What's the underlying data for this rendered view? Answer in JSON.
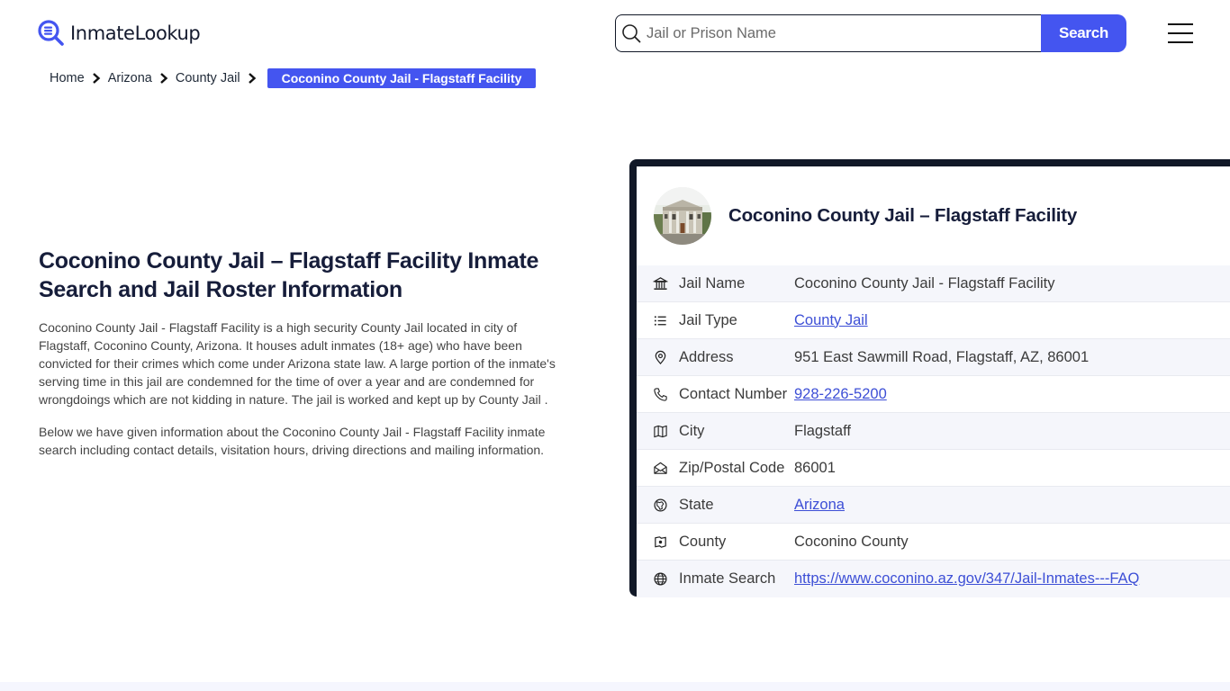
{
  "header": {
    "logo_text": "InmateLookup",
    "search": {
      "placeholder": "Jail or Prison Name",
      "value": "",
      "button_label": "Search"
    },
    "menu_icon": "hamburger-menu-icon"
  },
  "breadcrumb": {
    "items": [
      {
        "label": "Home"
      },
      {
        "label": "Arizona"
      },
      {
        "label": "County Jail"
      }
    ],
    "current": "Coconino County Jail - Flagstaff Facility"
  },
  "intro": {
    "title": "Coconino County Jail – Flagstaff Facility Inmate Search and Jail Roster Information",
    "paragraphs": [
      "Coconino County Jail - Flagstaff Facility is a high security County Jail located in city of Flagstaff, Coconino County, Arizona. It houses adult inmates (18+ age) who have been convicted for their crimes which come under Arizona state law. A large portion of the inmate's serving time in this jail are condemned for the time of over a year and are condemned for wrongdoings which are not kidding in nature. The jail is worked and kept up by County Jail .",
      "Below we have given information about the Coconino County Jail - Flagstaff Facility inmate search including contact details, visitation hours, driving directions and mailing information."
    ]
  },
  "card": {
    "title": "Coconino County Jail – Flagstaff Facility",
    "rows": [
      {
        "icon": "building-columns-icon",
        "label": "Jail Name",
        "value": "Coconino County Jail - Flagstaff Facility",
        "link": false
      },
      {
        "icon": "list-icon",
        "label": "Jail Type",
        "value": "County Jail",
        "link": true
      },
      {
        "icon": "map-pin-icon",
        "label": "Address",
        "value": "951 East Sawmill Road, Flagstaff, AZ, 86001",
        "link": false
      },
      {
        "icon": "phone-icon",
        "label": "Contact Number",
        "value": "928-226-5200",
        "link": true
      },
      {
        "icon": "map-icon",
        "label": "City",
        "value": "Flagstaff",
        "link": false
      },
      {
        "icon": "mail-open-icon",
        "label": "Zip/Postal Code",
        "value": "86001",
        "link": false
      },
      {
        "icon": "globe-pin-icon",
        "label": "State",
        "value": "Arizona",
        "link": true
      },
      {
        "icon": "county-map-icon",
        "label": "County",
        "value": "Coconino County",
        "link": false
      },
      {
        "icon": "world-icon",
        "label": "Inmate Search",
        "value": "https://www.coconino.az.gov/347/Jail-Inmates---FAQ",
        "link": true
      }
    ]
  },
  "colors": {
    "accent": "#4455f0",
    "card_frame": "#111827",
    "link": "#3d4fd6",
    "heading": "#161d3a"
  }
}
